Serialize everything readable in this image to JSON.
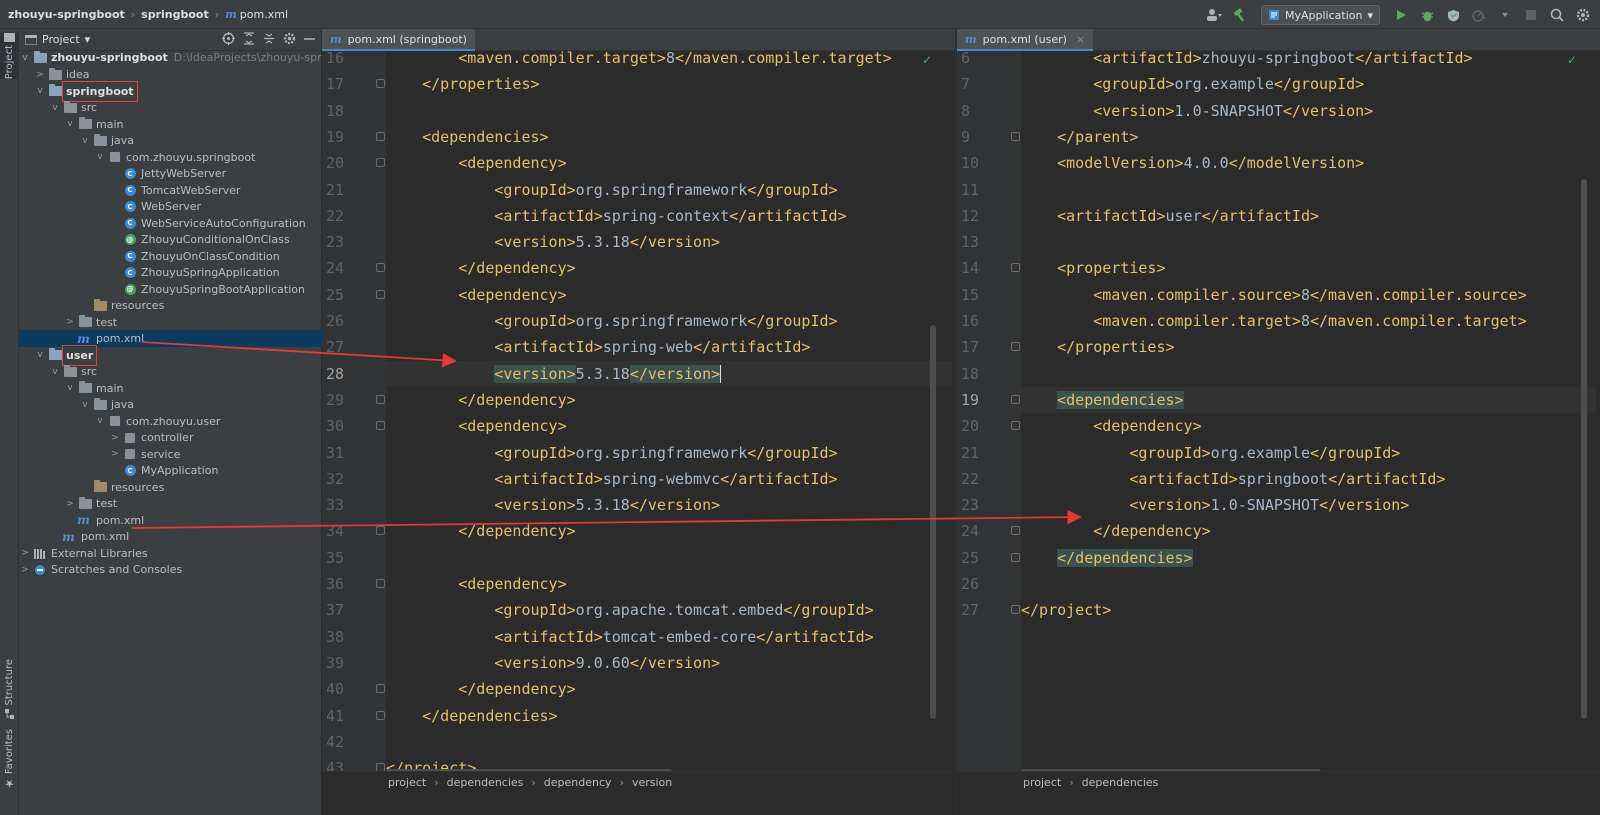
{
  "breadcrumb": {
    "project": "zhouyu-springboot",
    "module": "springboot",
    "file": "pom.xml",
    "file_icon": "m"
  },
  "toolbar": {
    "run_config": "MyApplication"
  },
  "stripe": {
    "project": "Project",
    "structure": "Structure",
    "favorites": "Favorites"
  },
  "project_panel": {
    "title": "Project",
    "root": {
      "name": "zhouyu-springboot",
      "path": "D:\\IdeaProjects\\zhouyu-springbo"
    },
    "rows": [
      {
        "label": "idea",
        "indent": 1,
        "chev": ">",
        "icon": "folder"
      },
      {
        "label": "springboot",
        "indent": 1,
        "chev": "v",
        "icon": "module",
        "bold": true,
        "boxed": true
      },
      {
        "label": "src",
        "indent": 2,
        "chev": "v",
        "icon": "folder"
      },
      {
        "label": "main",
        "indent": 3,
        "chev": "v",
        "icon": "folder"
      },
      {
        "label": "java",
        "indent": 4,
        "chev": "v",
        "icon": "folder"
      },
      {
        "label": "com.zhouyu.springboot",
        "indent": 5,
        "chev": "v",
        "icon": "package"
      },
      {
        "label": "JettyWebServer",
        "indent": 6,
        "chev": "",
        "icon": "class"
      },
      {
        "label": "TomcatWebServer",
        "indent": 6,
        "chev": "",
        "icon": "class"
      },
      {
        "label": "WebServer",
        "indent": 6,
        "chev": "",
        "icon": "class"
      },
      {
        "label": "WebServiceAutoConfiguration",
        "indent": 6,
        "chev": "",
        "icon": "class"
      },
      {
        "label": "ZhouyuConditionalOnClass",
        "indent": 6,
        "chev": "",
        "icon": "annotation"
      },
      {
        "label": "ZhouyuOnClassCondition",
        "indent": 6,
        "chev": "",
        "icon": "class"
      },
      {
        "label": "ZhouyuSpringApplication",
        "indent": 6,
        "chev": "",
        "icon": "class"
      },
      {
        "label": "ZhouyuSpringBootApplication",
        "indent": 6,
        "chev": "",
        "icon": "annotation"
      },
      {
        "label": "resources",
        "indent": 4,
        "chev": "",
        "icon": "resources"
      },
      {
        "label": "test",
        "indent": 3,
        "chev": ">",
        "icon": "folder"
      },
      {
        "label": "pom.xml",
        "indent": 3,
        "chev": "",
        "icon": "maven",
        "selected": true
      },
      {
        "label": "user",
        "indent": 1,
        "chev": "v",
        "icon": "module",
        "bold": true,
        "boxed": true
      },
      {
        "label": "src",
        "indent": 2,
        "chev": "v",
        "icon": "folder"
      },
      {
        "label": "main",
        "indent": 3,
        "chev": "v",
        "icon": "folder"
      },
      {
        "label": "java",
        "indent": 4,
        "chev": "v",
        "icon": "folder"
      },
      {
        "label": "com.zhouyu.user",
        "indent": 5,
        "chev": "v",
        "icon": "package"
      },
      {
        "label": "controller",
        "indent": 6,
        "chev": ">",
        "icon": "package"
      },
      {
        "label": "service",
        "indent": 6,
        "chev": ">",
        "icon": "package"
      },
      {
        "label": "MyApplication",
        "indent": 6,
        "chev": "",
        "icon": "class"
      },
      {
        "label": "resources",
        "indent": 4,
        "chev": "",
        "icon": "resources"
      },
      {
        "label": "test",
        "indent": 3,
        "chev": ">",
        "icon": "folder"
      },
      {
        "label": "pom.xml",
        "indent": 3,
        "chev": "",
        "icon": "maven"
      },
      {
        "label": "pom.xml",
        "indent": 2,
        "chev": "",
        "icon": "maven"
      },
      {
        "label": "External Libraries",
        "indent": 0,
        "chev": ">",
        "icon": "library"
      },
      {
        "label": "Scratches and Consoles",
        "indent": 0,
        "chev": ">",
        "icon": "scratch"
      }
    ]
  },
  "left_editor": {
    "tab": "pom.xml (springboot)",
    "current_line": "28",
    "lines": [
      {
        "n": "16",
        "text": "        <maven.compiler.target>8</maven.compiler.target>"
      },
      {
        "n": "17",
        "text": "    </properties>"
      },
      {
        "n": "18",
        "text": ""
      },
      {
        "n": "19",
        "text": "    <dependencies>"
      },
      {
        "n": "20",
        "text": "        <dependency>"
      },
      {
        "n": "21",
        "text": "            <groupId>org.springframework</groupId>"
      },
      {
        "n": "22",
        "text": "            <artifactId>spring-context</artifactId>"
      },
      {
        "n": "23",
        "text": "            <version>5.3.18</version>"
      },
      {
        "n": "24",
        "text": "        </dependency>"
      },
      {
        "n": "25",
        "text": "        <dependency>"
      },
      {
        "n": "26",
        "text": "            <groupId>org.springframework</groupId>"
      },
      {
        "n": "27",
        "text": "            <artifactId>spring-web</artifactId>"
      },
      {
        "n": "28",
        "text": "            <version>5.3.18</version>"
      },
      {
        "n": "29",
        "text": "        </dependency>"
      },
      {
        "n": "30",
        "text": "        <dependency>"
      },
      {
        "n": "31",
        "text": "            <groupId>org.springframework</groupId>"
      },
      {
        "n": "32",
        "text": "            <artifactId>spring-webmvc</artifactId>"
      },
      {
        "n": "33",
        "text": "            <version>5.3.18</version>"
      },
      {
        "n": "34",
        "text": "        </dependency>"
      },
      {
        "n": "35",
        "text": ""
      },
      {
        "n": "36",
        "text": "        <dependency>"
      },
      {
        "n": "37",
        "text": "            <groupId>org.apache.tomcat.embed</groupId>"
      },
      {
        "n": "38",
        "text": "            <artifactId>tomcat-embed-core</artifactId>"
      },
      {
        "n": "39",
        "text": "            <version>9.0.60</version>"
      },
      {
        "n": "40",
        "text": "        </dependency>"
      },
      {
        "n": "41",
        "text": "    </dependencies>"
      },
      {
        "n": "42",
        "text": ""
      },
      {
        "n": "43",
        "text": "</project>"
      }
    ],
    "crumbs": [
      "project",
      "dependencies",
      "dependency",
      "version"
    ]
  },
  "right_editor": {
    "tab": "pom.xml (user)",
    "current_line": "19",
    "lines": [
      {
        "n": "6",
        "text": "        <artifactId>zhouyu-springboot</artifactId>"
      },
      {
        "n": "7",
        "text": "        <groupId>org.example</groupId>"
      },
      {
        "n": "8",
        "text": "        <version>1.0-SNAPSHOT</version>"
      },
      {
        "n": "9",
        "text": "    </parent>"
      },
      {
        "n": "10",
        "text": "    <modelVersion>4.0.0</modelVersion>"
      },
      {
        "n": "11",
        "text": ""
      },
      {
        "n": "12",
        "text": "    <artifactId>user</artifactId>"
      },
      {
        "n": "13",
        "text": ""
      },
      {
        "n": "14",
        "text": "    <properties>"
      },
      {
        "n": "15",
        "text": "        <maven.compiler.source>8</maven.compiler.source>"
      },
      {
        "n": "16",
        "text": "        <maven.compiler.target>8</maven.compiler.target>"
      },
      {
        "n": "17",
        "text": "    </properties>"
      },
      {
        "n": "18",
        "text": ""
      },
      {
        "n": "19",
        "text": "    <dependencies>"
      },
      {
        "n": "20",
        "text": "        <dependency>"
      },
      {
        "n": "21",
        "text": "            <groupId>org.example</groupId>"
      },
      {
        "n": "22",
        "text": "            <artifactId>springboot</artifactId>"
      },
      {
        "n": "23",
        "text": "            <version>1.0-SNAPSHOT</version>"
      },
      {
        "n": "24",
        "text": "        </dependency>"
      },
      {
        "n": "25",
        "text": "    </dependencies>"
      },
      {
        "n": "26",
        "text": ""
      },
      {
        "n": "27",
        "text": "</project>"
      }
    ],
    "crumbs": [
      "project",
      "dependencies"
    ]
  },
  "colors": {
    "tag": "#e8bf6a",
    "text": "#a9b7c6",
    "arrow": "#e53935",
    "box": "#e04141",
    "selection": "#0d3a5f"
  }
}
